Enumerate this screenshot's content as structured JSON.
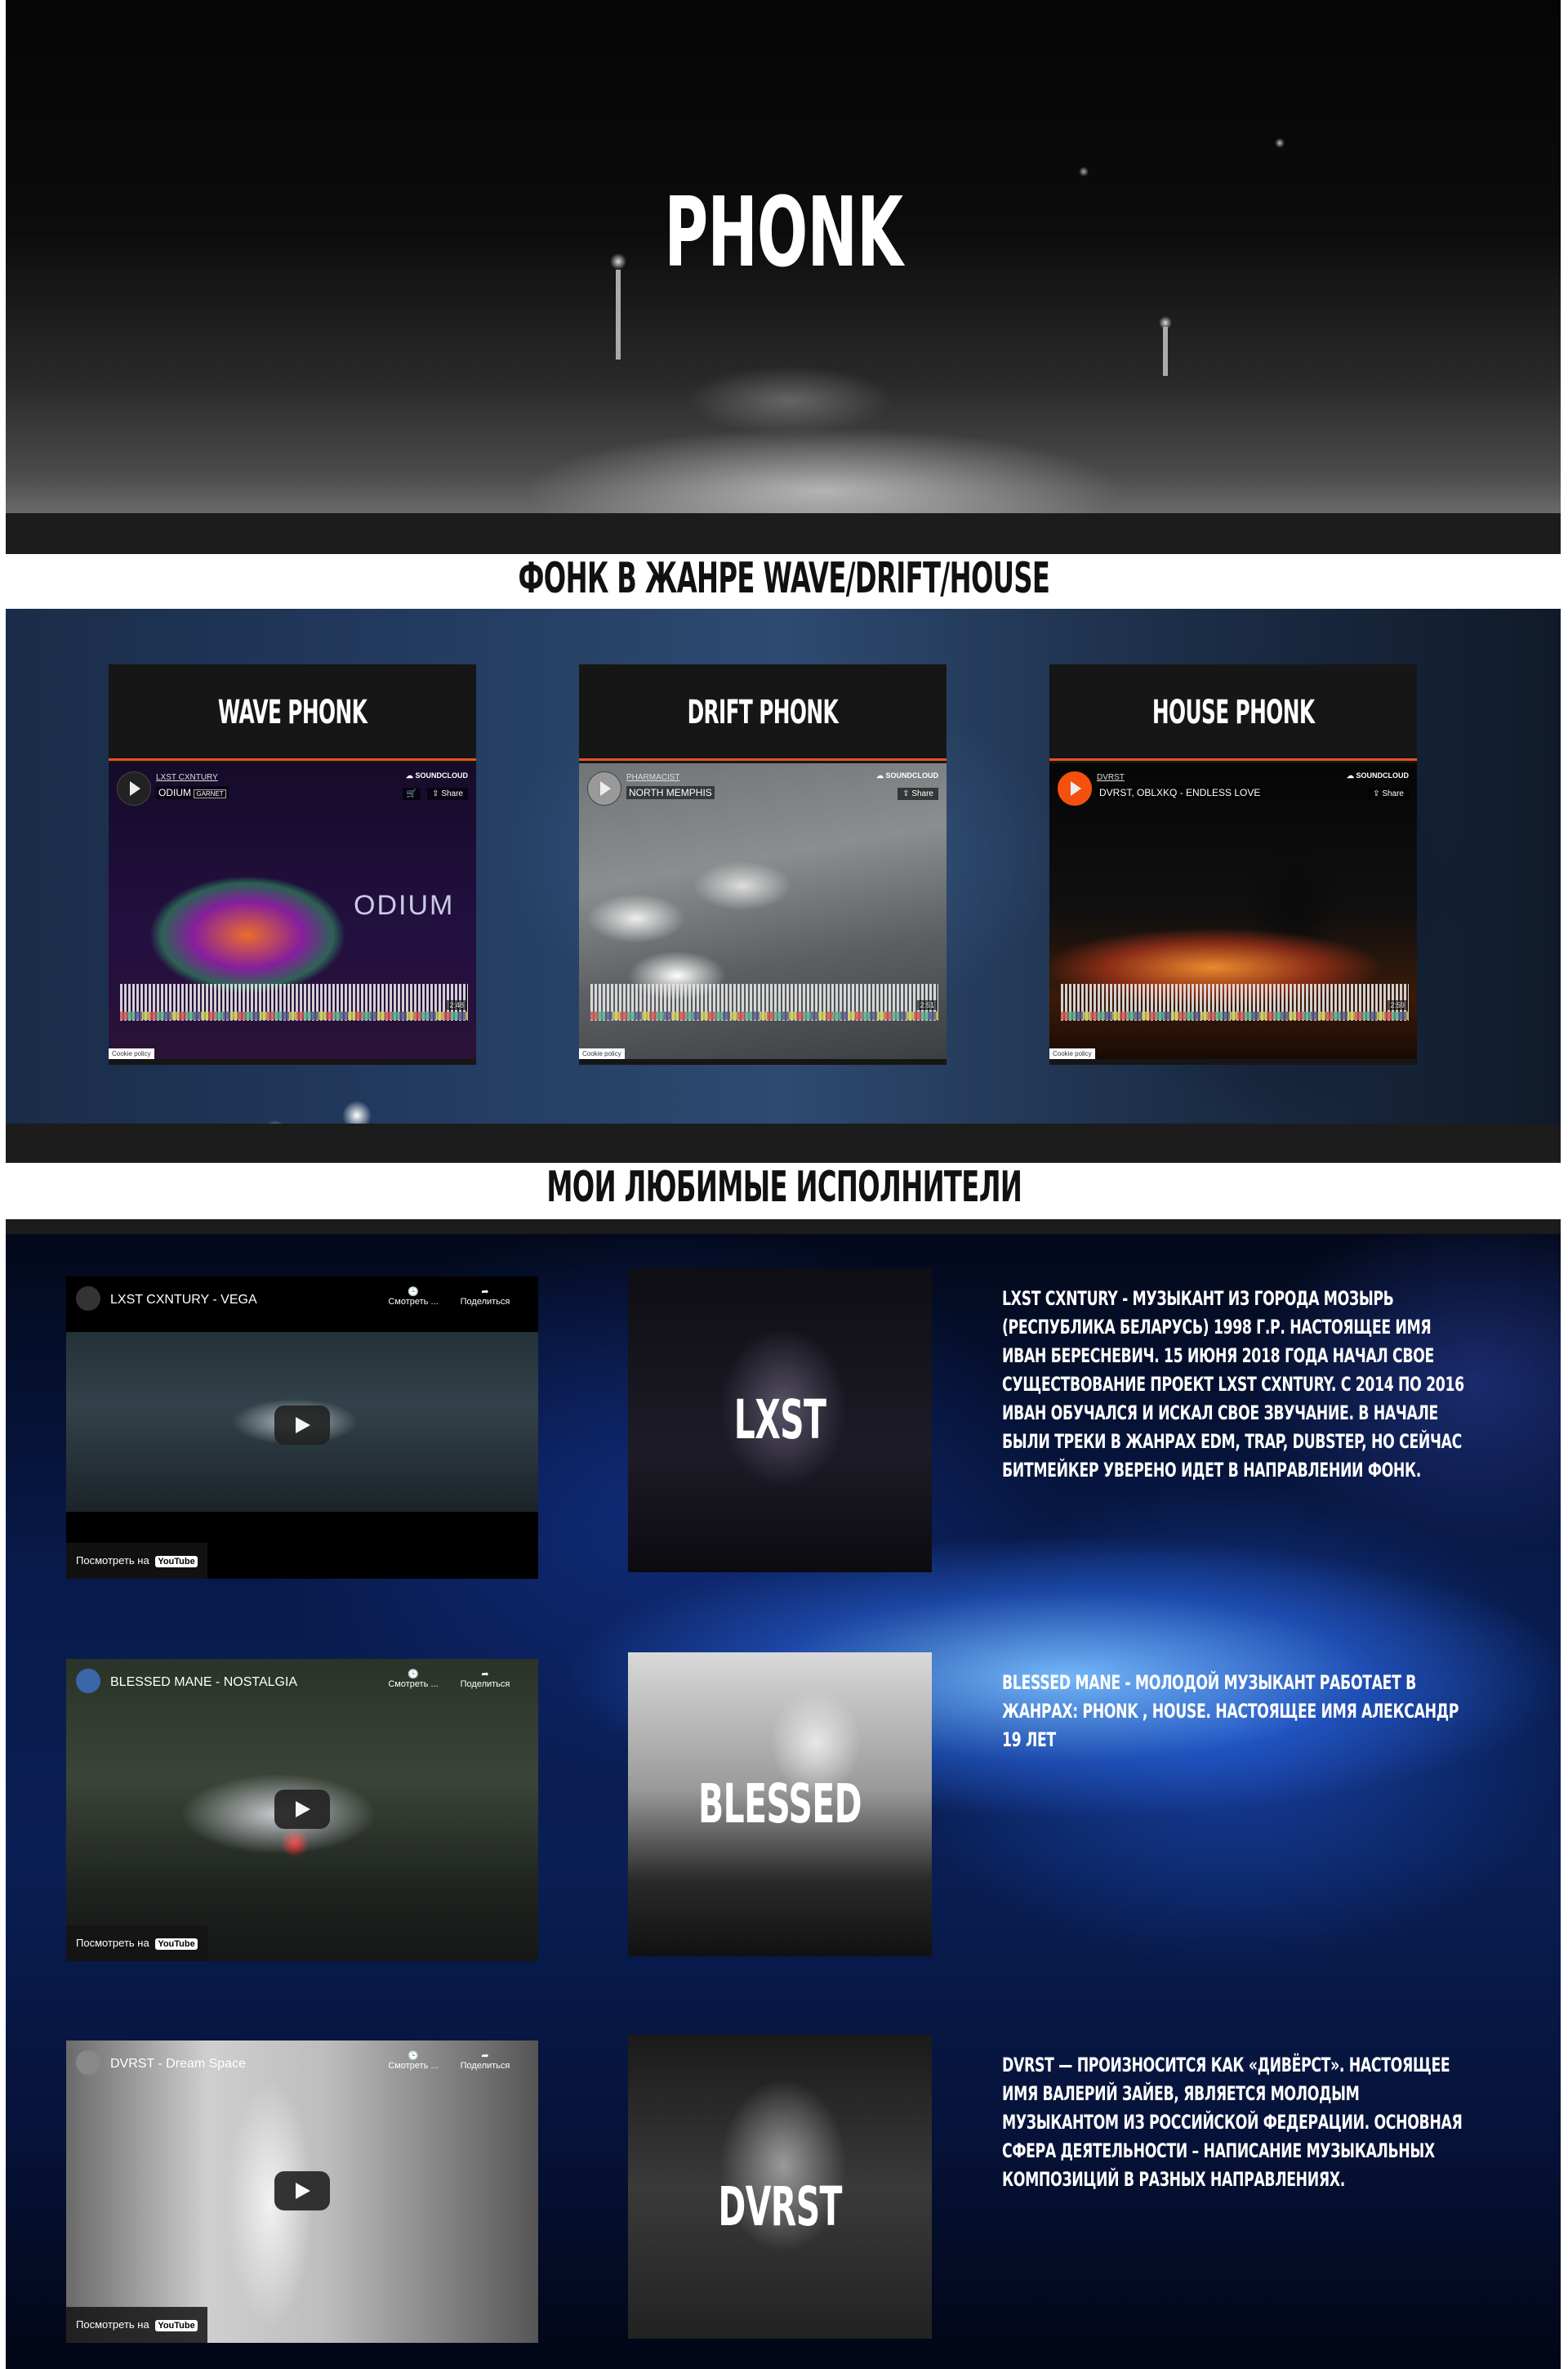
{
  "hero": {
    "title": "PHONK"
  },
  "genres_heading": "ФОНК В ЖАНРЕ WAVE/DRIFT/HOUSE",
  "genres": [
    {
      "title": "WAVE PHONK",
      "user": "LXST CXNTURY",
      "track": "ODIUM",
      "badge": "GARNET",
      "logo": "SOUNDCLOUD",
      "share": "Share",
      "cookie": "Cookie policy",
      "duration": "2:48",
      "art_text": "ODIUM"
    },
    {
      "title": "DRIFT PHONK",
      "user": "PHARMACIST",
      "track": "NORTH MEMPHIS",
      "logo": "SOUNDCLOUD",
      "share": "Share",
      "cookie": "Cookie policy",
      "duration": "2:51"
    },
    {
      "title": "HOUSE PHONK",
      "user": "DVRST",
      "track": "DVRST, OBLXKQ - ENDLESS LOVE",
      "logo": "SOUNDCLOUD",
      "share": "Share",
      "cookie": "Cookie policy",
      "duration": "2:59"
    }
  ],
  "artists_heading": "МОИ ЛЮБИМЫЕ ИСПОЛНИТЕЛИ",
  "video_labels": {
    "watch_later": "Смотреть ...",
    "share": "Поделиться",
    "watch_on": "Посмотреть на",
    "youtube": "YouTube"
  },
  "artists": [
    {
      "video_title": "LXST CXNTURY - VEGA",
      "name": "LXST CXNTURY",
      "bio": "LXST CXNTURY - Музыкант из города Мозырь (республика Беларусь) 1998 г.р. Настоящее имя Иван Бересневич. 15 июня 2018 года начал свое существование проект LXST CXNTURY. С 2014 по 2016 Иван обучался и искал свое звучание. В начале были треки в жанрах EDM, Trap, Dubstep, но сейчас битмейкер уверено идет в направлении Фонк."
    },
    {
      "video_title": "BLESSED MANE - NOSTALGIA",
      "name": "BLESSED MANE",
      "bio": "BLESSED MANE - молодой музыкант работает в жанрах: Phonk , house. Настоящее имя Александр 19 лет"
    },
    {
      "video_title": "DVRST - Dream Space",
      "name": "DVRST",
      "bio": "DVRST — произносится как «Дивёрст». Настоящее имя Валерий Зайев, является молодым музыкантом из Российской Федерации. Основная сфера деятельности – написание музыкальных композиций в разных направлениях."
    }
  ],
  "colors": {
    "accent": "#e8541e",
    "heading_text": "#111111",
    "section_strip": "#1c1c1c"
  }
}
